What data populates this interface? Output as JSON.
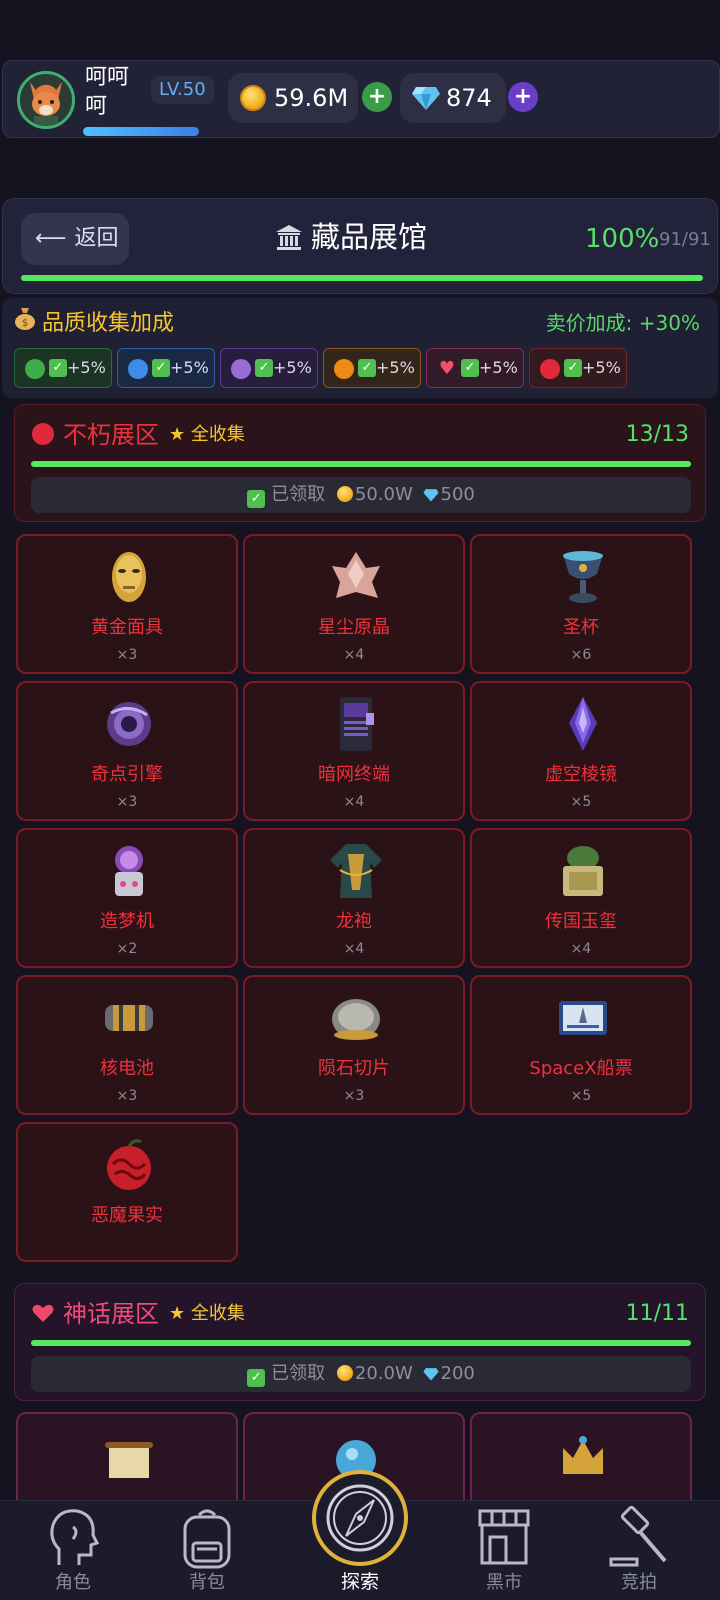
{
  "topbar": {
    "player_name": "呵呵呵",
    "level": "LV.50",
    "gold": "59.6M",
    "gems": "874",
    "plus": "+"
  },
  "header": {
    "back_label": "返回",
    "title": "藏品展馆",
    "percent": "100%",
    "count": "91/91"
  },
  "quality_bonus": {
    "title": "品质收集加成",
    "sell_bonus": "卖价加成: +30%",
    "chips": [
      {
        "color": "#3fae4a",
        "label": "+5%"
      },
      {
        "color": "#3d8de8",
        "label": "+5%"
      },
      {
        "color": "#9a6ad8",
        "label": "+5%"
      },
      {
        "color": "#f08a16",
        "label": "+5%"
      },
      {
        "color": "#e83a5a",
        "label": "+5%"
      },
      {
        "color": "#e02a3a",
        "label": "+5%"
      }
    ]
  },
  "zones": [
    {
      "name": "不朽展区",
      "full_label": "全收集",
      "count": "13/13",
      "claimed": "已领取",
      "reward_gold": "50.0W",
      "reward_gem": "500",
      "items": [
        {
          "name": "黄金面具",
          "qty": "×3"
        },
        {
          "name": "星尘原晶",
          "qty": "×4"
        },
        {
          "name": "圣杯",
          "qty": "×6"
        },
        {
          "name": "奇点引擎",
          "qty": "×3"
        },
        {
          "name": "暗网终端",
          "qty": "×4"
        },
        {
          "name": "虚空棱镜",
          "qty": "×5"
        },
        {
          "name": "造梦机",
          "qty": "×2"
        },
        {
          "name": "龙袍",
          "qty": "×4"
        },
        {
          "name": "传国玉玺",
          "qty": "×4"
        },
        {
          "name": "核电池",
          "qty": "×3"
        },
        {
          "name": "陨石切片",
          "qty": "×3"
        },
        {
          "name": "SpaceX船票",
          "qty": "×5"
        },
        {
          "name": "恶魔果实",
          "qty": ""
        }
      ]
    },
    {
      "name": "神话展区",
      "full_label": "全收集",
      "count": "11/11",
      "claimed": "已领取",
      "reward_gold": "20.0W",
      "reward_gem": "200"
    }
  ],
  "nav": {
    "role": "角色",
    "bag": "背包",
    "explore": "探索",
    "market": "黑市",
    "auction": "竞拍"
  }
}
